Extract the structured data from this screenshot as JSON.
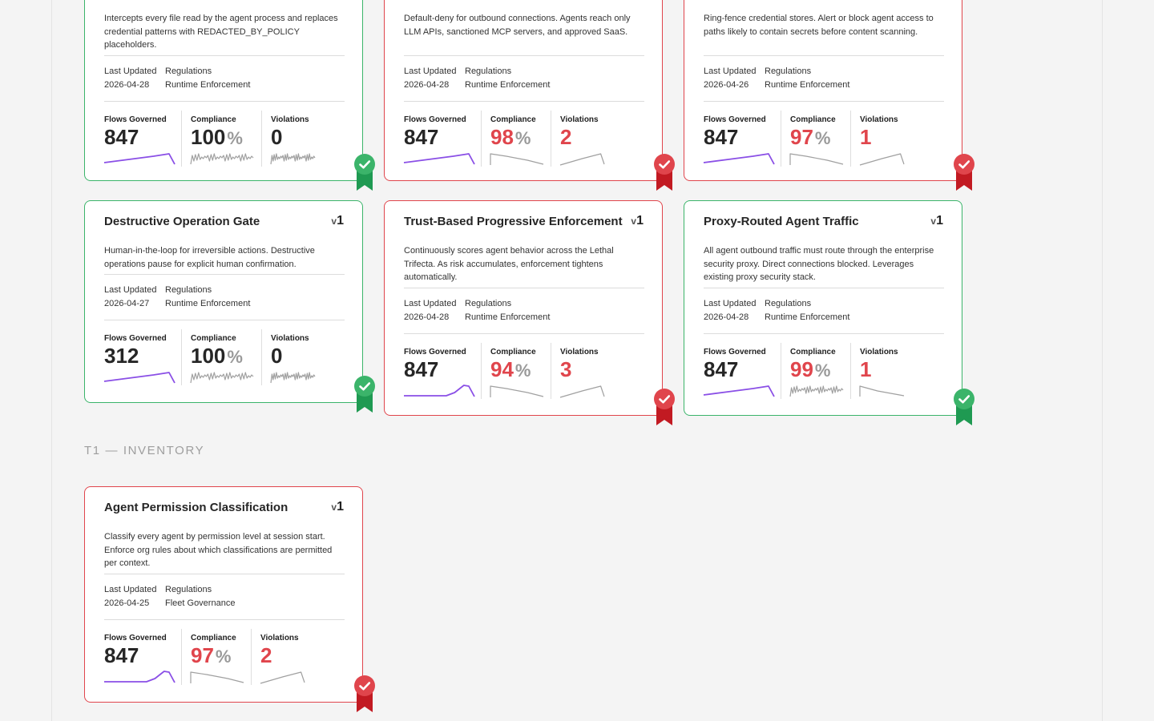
{
  "labels": {
    "last_updated": "Last Updated",
    "regulations": "Regulations",
    "flows_governed": "Flows Governed",
    "compliance": "Compliance",
    "violations": "Violations",
    "version_prefix": "v",
    "percent": "%"
  },
  "colors": {
    "pass_border": "#3bb46a",
    "fail_border": "#e0454c",
    "sparkline_flows": "#8a4fe6",
    "sparkline_other": "#a0a0a0",
    "bad_value": "#e0454c",
    "badge_pass": "#3bb46a",
    "badge_fail": "#e0454c"
  },
  "section": {
    "title": "T1 — INVENTORY"
  },
  "cards": [
    {
      "title": "",
      "version": "1",
      "description": "Intercepts every file read by the agent process and replaces credential patterns with REDACTED_BY_POLICY placeholders.",
      "last_updated": "2026-04-28",
      "regulation": "Runtime Enforcement",
      "flows": "847",
      "compliance": "100",
      "violations": "0",
      "status": "pass",
      "badge_icon": "check-ribbon-icon"
    },
    {
      "title": "",
      "version": "1",
      "description": "Default-deny for outbound connections. Agents reach only LLM APIs, sanctioned MCP servers, and approved SaaS.",
      "last_updated": "2026-04-28",
      "regulation": "Runtime Enforcement",
      "flows": "847",
      "compliance": "98",
      "violations": "2",
      "status": "fail",
      "badge_icon": "check-ribbon-icon"
    },
    {
      "title": "",
      "version": "1",
      "description": "Ring-fence credential stores. Alert or block agent access to paths likely to contain secrets before content scanning.",
      "last_updated": "2026-04-26",
      "regulation": "Runtime Enforcement",
      "flows": "847",
      "compliance": "97",
      "violations": "1",
      "status": "fail",
      "badge_icon": "check-ribbon-icon"
    },
    {
      "title": "Destructive Operation Gate",
      "version": "1",
      "description": "Human-in-the-loop for irreversible actions. Destructive operations pause for explicit human confirmation.",
      "last_updated": "2026-04-27",
      "regulation": "Runtime Enforcement",
      "flows": "312",
      "compliance": "100",
      "violations": "0",
      "status": "pass",
      "badge_icon": "check-ribbon-icon"
    },
    {
      "title": "Trust-Based Progressive Enforcement",
      "version": "1",
      "description": "Continuously scores agent behavior across the Lethal Trifecta. As risk accumulates, enforcement tightens automatically.",
      "last_updated": "2026-04-28",
      "regulation": "Runtime Enforcement",
      "flows": "847",
      "compliance": "94",
      "violations": "3",
      "status": "fail",
      "badge_icon": "check-ribbon-icon"
    },
    {
      "title": "Proxy-Routed Agent Traffic",
      "version": "1",
      "description": "All agent outbound traffic must route through the enterprise security proxy. Direct connections blocked. Leverages existing proxy security stack.",
      "last_updated": "2026-04-28",
      "regulation": "Runtime Enforcement",
      "flows": "847",
      "compliance": "99",
      "violations": "1",
      "status": "pass",
      "badge_icon": "check-ribbon-icon"
    },
    {
      "title": "Agent Permission Classification",
      "version": "1",
      "description": "Classify every agent by permission level at session start. Enforce org rules about which classifications are permitted per context.",
      "last_updated": "2026-04-25",
      "regulation": "Fleet Governance",
      "flows": "847",
      "compliance": "97",
      "violations": "2",
      "status": "fail",
      "badge_icon": "check-ribbon-icon"
    }
  ]
}
